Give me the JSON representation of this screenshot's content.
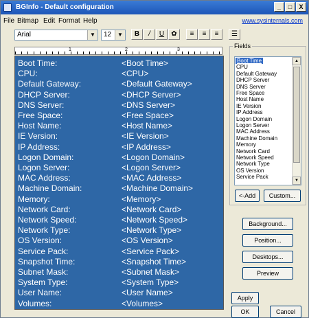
{
  "window": {
    "title": "BGInfo - Default configuration",
    "minimize": "_",
    "maximize": "□",
    "close": "X"
  },
  "menu": {
    "items": [
      "File",
      "Bitmap",
      "Edit",
      "Format",
      "Help"
    ],
    "link": "www.sysinternals.com"
  },
  "toolbar": {
    "font": "Arial",
    "size": "12",
    "bold": "B",
    "italic": "/",
    "underline": "U",
    "color": "✿",
    "align_left": "≡",
    "align_center": "≡",
    "align_right": "≡",
    "bullets": "☰"
  },
  "ruler": {
    "marks": [
      "1",
      "2",
      "3"
    ]
  },
  "editor": {
    "rows": [
      {
        "label": "Boot Time:",
        "token": "<Boot Time>"
      },
      {
        "label": "CPU:",
        "token": "<CPU>"
      },
      {
        "label": "Default Gateway:",
        "token": "<Default Gateway>"
      },
      {
        "label": "DHCP Server:",
        "token": "<DHCP Server>"
      },
      {
        "label": "DNS Server:",
        "token": "<DNS Server>"
      },
      {
        "label": "Free Space:",
        "token": "<Free Space>"
      },
      {
        "label": "Host Name:",
        "token": "<Host Name>"
      },
      {
        "label": "IE Version:",
        "token": "<IE Version>"
      },
      {
        "label": "IP Address:",
        "token": "<IP Address>"
      },
      {
        "label": "Logon Domain:",
        "token": "<Logon Domain>"
      },
      {
        "label": "Logon Server:",
        "token": "<Logon Server>"
      },
      {
        "label": "MAC Address:",
        "token": "<MAC Address>"
      },
      {
        "label": "Machine Domain:",
        "token": "<Machine Domain>"
      },
      {
        "label": "Memory:",
        "token": "<Memory>"
      },
      {
        "label": "Network Card:",
        "token": "<Network Card>"
      },
      {
        "label": "Network Speed:",
        "token": "<Network Speed>"
      },
      {
        "label": "Network Type:",
        "token": "<Network Type>"
      },
      {
        "label": "OS Version:",
        "token": "<OS Version>"
      },
      {
        "label": "Service Pack:",
        "token": "<Service Pack>"
      },
      {
        "label": "Snapshot Time:",
        "token": "<Snapshot Time>"
      },
      {
        "label": "Subnet Mask:",
        "token": "<Subnet Mask>"
      },
      {
        "label": "System Type:",
        "token": "<System Type>"
      },
      {
        "label": "User Name:",
        "token": "<User Name>"
      },
      {
        "label": "Volumes:",
        "token": "<Volumes>"
      }
    ]
  },
  "fields": {
    "title": "Fields",
    "items": [
      "Boot Time",
      "CPU",
      "Default Gateway",
      "DHCP Server",
      "DNS Server",
      "Free Space",
      "Host Name",
      "IE Version",
      "IP Address",
      "Logon Domain",
      "Logon Server",
      "MAC Address",
      "Machine Domain",
      "Memory",
      "Network Card",
      "Network Speed",
      "Network Type",
      "OS Version",
      "Service Pack"
    ],
    "selected": "Boot Time",
    "add": "<-Add",
    "custom": "Custom..."
  },
  "buttons": {
    "background": "Background...",
    "position": "Position...",
    "desktops": "Desktops...",
    "preview": "Preview",
    "apply": "Apply",
    "ok": "OK",
    "cancel": "Cancel"
  },
  "colors": {
    "editor_bg": "#2e67a6",
    "title_bar": "#1d56b8",
    "selection": "#316ac5"
  }
}
